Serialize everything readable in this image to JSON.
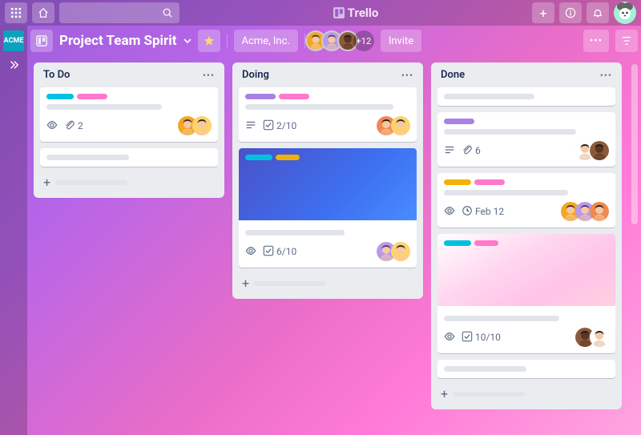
{
  "brand": "Trello",
  "workspace_tile": "ACME",
  "board": {
    "name": "Project Team Spirit",
    "org": "Acme, Inc.",
    "extra_members": "+12",
    "invite_label": "Invite"
  },
  "avatars": {
    "p1": {
      "bg": "#f5a623",
      "hair": "#4a3420"
    },
    "p2": {
      "bg": "#ffd36b",
      "hair": "#2a2a2a"
    },
    "p3": {
      "bg": "#f08850",
      "hair": "#3a1f10"
    },
    "p4": {
      "bg": "#b89ae8",
      "hair": "#5a3580"
    },
    "p5": {
      "bg": "#ffffff",
      "hair": "#1a1a1a"
    },
    "p6": {
      "bg": "#8b5a3c",
      "hair": "#1a1a1a",
      "skin": "#5a3520"
    }
  },
  "colors": {
    "cyan": "#00c2e0",
    "pink": "#ff78cb",
    "purple": "#a781e5",
    "yellow": "#f2b203"
  },
  "lists": [
    {
      "title": "To Do",
      "cards": [
        {
          "labels": [
            "cyan",
            "pink"
          ],
          "lines": [
            70
          ],
          "badges": {
            "watch": true,
            "attach": "2"
          },
          "assignees": [
            "p1",
            "p2"
          ]
        },
        {
          "labels": [],
          "lines": [
            50
          ],
          "badges": {},
          "assignees": []
        }
      ]
    },
    {
      "title": "Doing",
      "cards": [
        {
          "labels": [
            "purple",
            "pink"
          ],
          "lines": [
            90
          ],
          "badges": {
            "desc": true,
            "check": "2/10"
          },
          "assignees": [
            "p3",
            "p2"
          ]
        },
        {
          "cover": "blue",
          "cover_labels": [
            "cyan",
            "yellow"
          ],
          "labels": [],
          "lines": [
            60
          ],
          "badges": {
            "watch": true,
            "check": "6/10"
          },
          "assignees": [
            "p4",
            "p2"
          ]
        }
      ]
    },
    {
      "title": "Done",
      "cards": [
        {
          "labels": [],
          "lines": [
            55
          ],
          "badges": {},
          "assignees": []
        },
        {
          "labels": [
            "purple"
          ],
          "lines": [
            80
          ],
          "badges": {
            "desc": true,
            "attach": "6"
          },
          "assignees": [
            "p5",
            "p6"
          ]
        },
        {
          "labels": [
            "yellow",
            "pink"
          ],
          "lines": [
            75
          ],
          "badges": {
            "watch": true,
            "due": "Feb 12"
          },
          "assignees": [
            "p1",
            "p4",
            "p3"
          ]
        },
        {
          "cover": "pink",
          "cover_labels": [
            "cyan",
            "pink"
          ],
          "labels": [],
          "lines": [
            70
          ],
          "badges": {
            "watch": true,
            "check": "10/10"
          },
          "assignees": [
            "p6",
            "p5"
          ]
        },
        {
          "labels": [],
          "lines": [
            50
          ],
          "badges": {},
          "assignees": []
        }
      ]
    }
  ]
}
